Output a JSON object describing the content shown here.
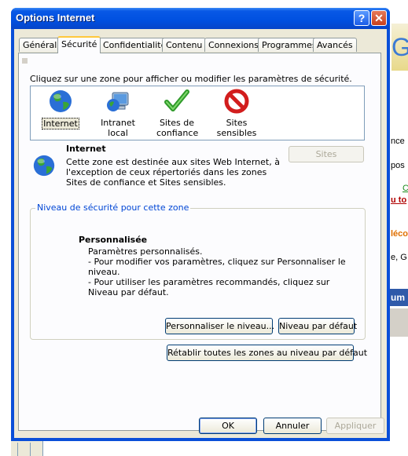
{
  "window": {
    "title": "Options Internet",
    "help_glyph": "?",
    "close_glyph": "✕"
  },
  "tabs": [
    {
      "label": "Général",
      "active": false
    },
    {
      "label": "Sécurité",
      "active": true
    },
    {
      "label": "Confidentialité",
      "active": false
    },
    {
      "label": "Contenu",
      "active": false
    },
    {
      "label": "Connexions",
      "active": false
    },
    {
      "label": "Programmes",
      "active": false
    },
    {
      "label": "Avancés",
      "active": false
    }
  ],
  "security": {
    "instruction": "Cliquez sur une zone pour afficher ou modifier les paramètres de sécurité.",
    "zones": [
      {
        "label": "Internet",
        "icon": "globe-icon",
        "selected": true
      },
      {
        "label": "Intranet local",
        "icon": "intranet-icon",
        "selected": false
      },
      {
        "label": "Sites de confiance",
        "icon": "checkmark-icon",
        "selected": false
      },
      {
        "label": "Sites sensibles",
        "icon": "restricted-icon",
        "selected": false
      }
    ],
    "zone_info": {
      "title": "Internet",
      "description": "Cette zone est destinée aux sites Web Internet, à l'exception de ceux répertoriés dans les zones Sites de confiance et Sites sensibles.",
      "sites_button": "Sites"
    },
    "level_group": {
      "legend": "Niveau de sécurité pour cette zone",
      "title": "Personnalisée",
      "lines": [
        "Paramètres personnalisés.",
        "- Pour modifier vos paramètres, cliquez sur Personnaliser le niveau.",
        "- Pour utiliser les paramètres recommandés, cliquez sur Niveau par défaut."
      ],
      "customize_button": "Personnaliser le niveau...",
      "default_button": "Niveau par défaut"
    },
    "reset_all_button": "Rétablir toutes les zones au niveau par défaut"
  },
  "dialog_buttons": {
    "ok": "OK",
    "cancel": "Annuler",
    "apply": "Appliquer"
  },
  "background_fragments": [
    "nce",
    "pos",
    "C",
    "u to",
    "léco",
    "e, G",
    "um"
  ],
  "colors": {
    "title_bar": "#0050e0",
    "dialog_face": "#ece9d8",
    "group_legend": "#0046d5",
    "active_tab_highlight": "#ffc83c"
  }
}
